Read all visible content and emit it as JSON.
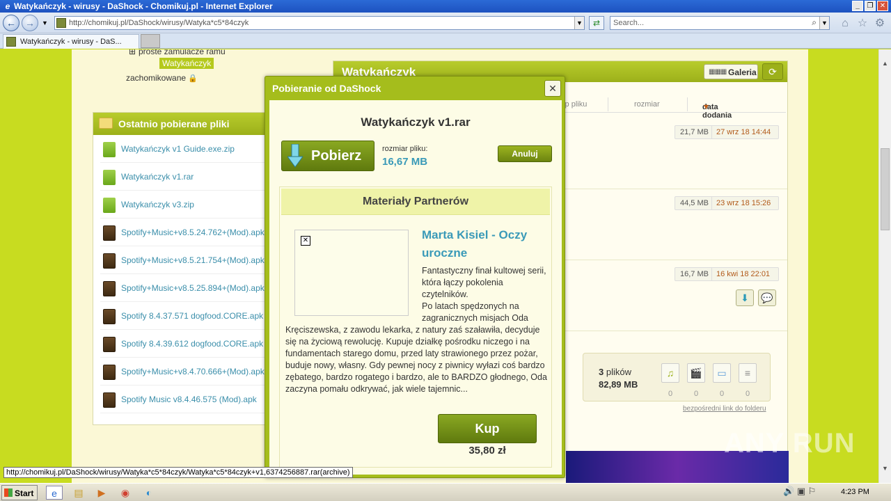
{
  "window": {
    "title": "Watykańczyk - wirusy - DaShock - Chomikuj.pl - Internet Explorer",
    "min": "_",
    "max": "❐",
    "close": "✕"
  },
  "address": {
    "url": "http://chomikuj.pl/DaShock/wirusy/Watyka*c5*84czyk",
    "search_placeholder": "Search..."
  },
  "tab": {
    "label": "Watykańczyk - wirusy - DaS..."
  },
  "tree": {
    "item1": "proste zamulacze ramu",
    "item2": "Watykańczyk",
    "item3": "zachomikowane"
  },
  "recent": {
    "title": "Ostatnio pobierane pliki",
    "files": [
      {
        "name": "Watykańczyk v1 Guide.exe.zip",
        "type": "zip"
      },
      {
        "name": "Watykańczyk v1.rar",
        "type": "zip"
      },
      {
        "name": "Watykańczyk v3.zip",
        "type": "zip"
      },
      {
        "name": "Spotify+Music+v8.5.24.762+(Mod).apk",
        "type": "apk"
      },
      {
        "name": "Spotify+Music+v8.5.21.754+(Mod).apk",
        "type": "apk"
      },
      {
        "name": "Spotify+Music+v8.5.25.894+(Mod).apk",
        "type": "apk"
      },
      {
        "name": "Spotify 8.4.37.571 dogfood.CORE.apk",
        "type": "apk"
      },
      {
        "name": "Spotify 8.4.39.612 dogfood.CORE.apk",
        "type": "apk"
      },
      {
        "name": "Spotify+Music+v8.4.70.666+(Mod).apk",
        "type": "apk"
      },
      {
        "name": "Spotify Music v8.4.46.575 (Mod).apk",
        "type": "apk"
      }
    ]
  },
  "folder": {
    "title": "Watykańczyk",
    "galeria": "Galeria",
    "cols": {
      "type": "typ pliku",
      "size": "rozmiar",
      "date": "data dodania"
    },
    "files": [
      {
        "size": "21,7 MB",
        "date": "27 wrz 18 14:44"
      },
      {
        "size": "44,5 MB",
        "date": "23 wrz 18 15:26"
      },
      {
        "size": "16,7 MB",
        "date": "16 kwi 18 22:01"
      }
    ],
    "stats": {
      "count_num": "3",
      "count_word": "plików",
      "total": "82,89 MB",
      "music": "0",
      "video": "0",
      "images": "0",
      "docs": "0"
    },
    "direct_link": "bezpośredni link do folderu"
  },
  "modal": {
    "title": "Pobieranie od DaShock",
    "close": "✕",
    "filename": "Watykańczyk v1.rar",
    "download_label": "Pobierz",
    "size_label": "rozmiar pliku:",
    "size_value": "16,67 MB",
    "cancel_label": "Anuluj",
    "partners_title": "Materiały Partnerów",
    "book_title": "Marta Kisiel - Oczy uroczne",
    "book_desc_1": "Fantastyczny finał kultowej serii, która łączy pokolenia czytelników.",
    "book_desc_2": "Po latach spędzonych na zagranicznych misjach Oda",
    "book_desc_3": "Kręciszewska, z zawodu lekarka, z natury zaś szaławiła, decyduje się na życiową rewolucję. Kupuje działkę pośrodku niczego i na fundamentach starego domu, przed laty strawionego przez pożar, buduje nowy, własny. Gdy pewnej nocy z piwnicy wyłazi coś bardzo zębatego, bardzo rogatego i bardzo, ale to BARDZO głodnego, Oda zaczyna pomału odkrywać, jak wiele tajemnic...",
    "buy_label": "Kup",
    "price": "35,80 zł"
  },
  "status_url": "http://chomikuj.pl/DaShock/wirusy/Watyka*c5*84czyk/Watyka*c5*84czyk+v1,6374256887.rar(archive)",
  "taskbar": {
    "start": "Start",
    "clock": "4:23 PM"
  },
  "watermark": "ANY RUN"
}
